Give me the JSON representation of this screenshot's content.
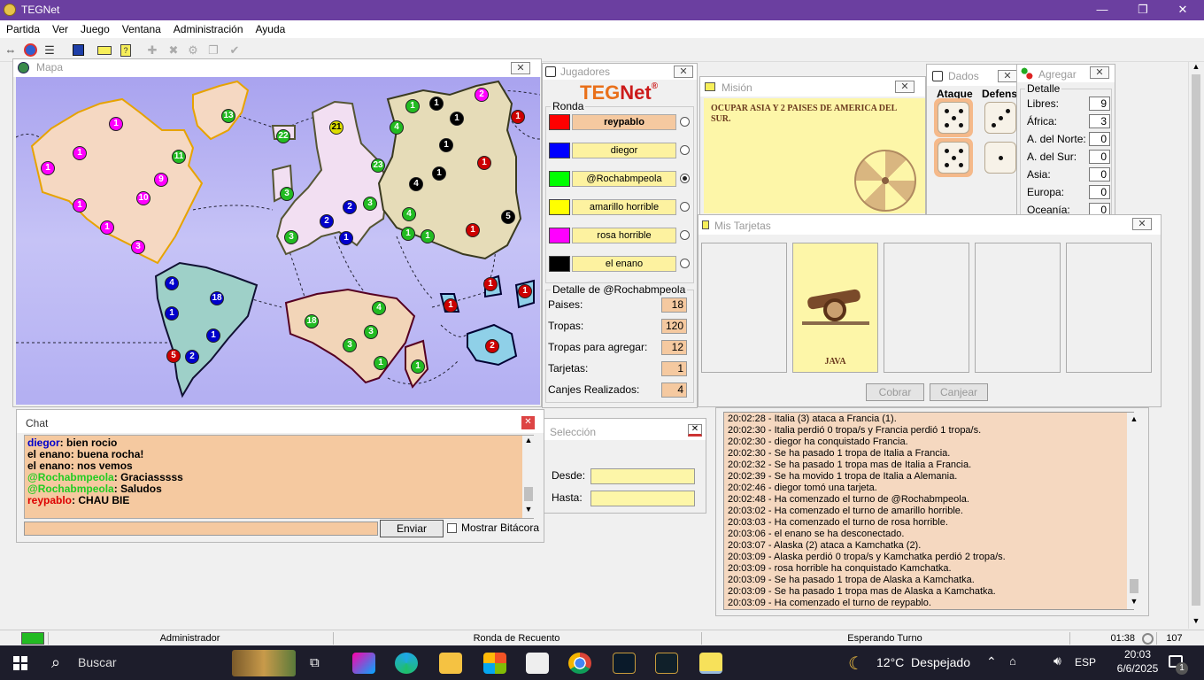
{
  "app": {
    "title": "TEGNet"
  },
  "window_controls": {
    "minimize": "—",
    "maximize": "❐",
    "close": "✕"
  },
  "menu": [
    "Partida",
    "Ver",
    "Juego",
    "Ventana",
    "Administración",
    "Ayuda"
  ],
  "toolbar": {
    "icons": [
      "connect-icon",
      "globe-icon",
      "list-icon",
      "save-icon",
      "card-icon",
      "card-question-icon",
      "add-icon",
      "cross-icon",
      "gear-icon",
      "copy-icon",
      "check-icon"
    ]
  },
  "mapa": {
    "title": "Mapa"
  },
  "jugadores": {
    "title": "Jugadores",
    "logo_a": "TEG",
    "logo_b": "Net",
    "logo_reg": "®",
    "ronda_label": "Ronda",
    "players": [
      {
        "name": "reypablo",
        "color": "#ff0000",
        "active": false,
        "bold": true
      },
      {
        "name": "diegor",
        "color": "#0000ff",
        "active": false,
        "bold": false
      },
      {
        "name": "@Rochabmpeola",
        "color": "#00ff00",
        "active": true,
        "bold": false
      },
      {
        "name": "amarillo horrible",
        "color": "#ffff00",
        "active": false,
        "bold": false
      },
      {
        "name": "rosa horrible",
        "color": "#ff00ff",
        "active": false,
        "bold": false
      },
      {
        "name": "el enano",
        "color": "#000000",
        "active": false,
        "bold": false
      }
    ],
    "detail_title": "Detalle de @Rochabmpeola",
    "details": [
      {
        "label": "Paises:",
        "value": "18"
      },
      {
        "label": "Tropas:",
        "value": "120"
      },
      {
        "label": "Tropas para agregar:",
        "value": "12"
      },
      {
        "label": "Tarjetas:",
        "value": "1"
      },
      {
        "label": "Canjes Realizados:",
        "value": "4"
      }
    ]
  },
  "mision": {
    "title": "Misión",
    "text": "OCUPAR ASIA Y 2 PAISES DE AMERICA DEL SUR."
  },
  "dados": {
    "title": "Dados",
    "ataque": "Ataque",
    "defensa": "Defens",
    "attack_dice": [
      5,
      5
    ],
    "defense_dice": [
      3,
      1
    ]
  },
  "agregar": {
    "title": "Agregar",
    "group": "Detalle",
    "rows": [
      {
        "label": "Libres:",
        "value": "9"
      },
      {
        "label": "África:",
        "value": "3"
      },
      {
        "label": "A. del Norte:",
        "value": "0"
      },
      {
        "label": "A. del Sur:",
        "value": "0"
      },
      {
        "label": "Asia:",
        "value": "0"
      },
      {
        "label": "Europa:",
        "value": "0"
      },
      {
        "label": "Oceanía:",
        "value": "0"
      }
    ]
  },
  "tarjetas": {
    "title": "Mis Tarjetas",
    "card_name": "JAVA",
    "cobrar": "Cobrar",
    "canjear": "Canjear"
  },
  "chat": {
    "title": "Chat",
    "lines": [
      {
        "user": "diegor",
        "color": "#0000cc",
        "text": "bien rocio"
      },
      {
        "user": "el enano",
        "color": "#000000",
        "text": "buena rocha!"
      },
      {
        "user": "el enano",
        "color": "#000000",
        "text": "nos vemos"
      },
      {
        "user": "@Rochabmpeola",
        "color": "#22cc22",
        "text": "Graciasssss"
      },
      {
        "user": "@Rochabmpeola",
        "color": "#22cc22",
        "text": "Saludos"
      },
      {
        "user": "reypablo",
        "color": "#dd0000",
        "text": "CHAU BIE"
      }
    ],
    "input": "",
    "send": "Enviar",
    "show_log": "Mostrar Bitácora"
  },
  "seleccion": {
    "title": "Selección",
    "desde": "Desde:",
    "hasta": "Hasta:",
    "desde_value": "",
    "hasta_value": ""
  },
  "log": [
    "20:02:28 - Italia (3) ataca a Francia (1).",
    "20:02:30 - Italia perdió 0 tropa/s y Francia perdió 1 tropa/s.",
    "20:02:30 - diegor ha conquistado Francia.",
    "20:02:30 - Se ha pasado 1 tropa de Italia a Francia.",
    "20:02:32 - Se ha pasado 1 tropa mas de Italia a Francia.",
    "20:02:39 - Se ha movido 1 tropa de Italia a Alemania.",
    "20:02:46 - diegor tomó una tarjeta.",
    "20:02:48 - Ha comenzado el turno de @Rochabmpeola.",
    "20:03:02 - Ha comenzado el turno de amarillo horrible.",
    "20:03:03 - Ha comenzado el turno de rosa horrible.",
    "20:03:06 - el enano se ha desconectado.",
    "20:03:07 - Alaska (2) ataca a Kamchatka (2).",
    "20:03:09 - Alaska perdió 0 tropa/s y Kamchatka perdió 2 tropa/s.",
    "20:03:09 - rosa horrible ha conquistado Kamchatka.",
    "20:03:09 - Se ha pasado 1 tropa de Alaska a Kamchatka.",
    "20:03:09 - Se ha pasado 1 tropa mas de Alaska a Kamchatka.",
    "20:03:09 - Ha comenzado el turno de reypablo."
  ],
  "status": {
    "role": "Administrador",
    "phase": "Ronda de Recuento",
    "turn": "Esperando Turno",
    "time": "01:38",
    "count": "107",
    "indicator_color": "#22bb22"
  },
  "taskbar": {
    "search": "Buscar",
    "weather": "12°C  Despejado",
    "lang": "ESP",
    "clock_time": "20:03",
    "clock_date": "6/6/2025",
    "notif_count": "1"
  }
}
